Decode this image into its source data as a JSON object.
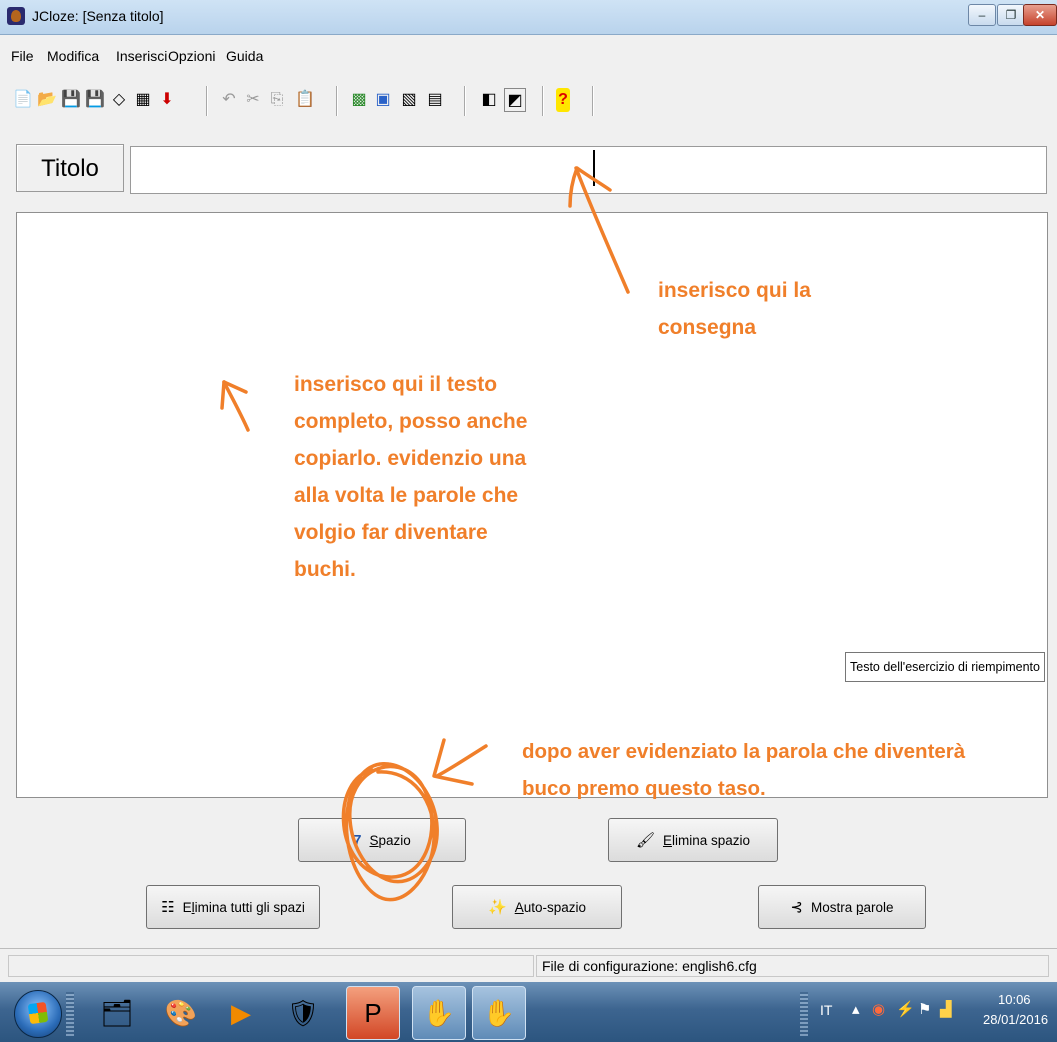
{
  "window": {
    "title": "JCloze: [Senza titolo]",
    "min": "–",
    "max": "❐",
    "close": "✕"
  },
  "menu": [
    "File",
    "Modifica",
    "Inserisci",
    "Opzioni",
    "Guida"
  ],
  "toolbar_icons": [
    "new-file-icon",
    "open-folder-icon",
    "save-icon",
    "save-as-icon",
    "eraser-icon",
    "web-page-icon",
    "export-icon",
    "undo-icon",
    "cut-icon",
    "copy-icon",
    "paste-icon",
    "export-html-icon",
    "export-flash-icon",
    "export-drag-icon",
    "export-print-icon",
    "properties-icon",
    "settings-icon",
    "help-icon"
  ],
  "title_row": {
    "label": "Titolo",
    "value": ""
  },
  "editor": {
    "text": "",
    "tooltip": "Testo dell'esercizio di riempimento"
  },
  "buttons": {
    "gap": {
      "prefix": "",
      "accel": "S",
      "rest": "pazio"
    },
    "delete_gap": {
      "prefix": "",
      "accel": "E",
      "rest": "limina spazio"
    },
    "delete_all": {
      "prefix": "E",
      "accel": "l",
      "rest": "imina tutti gli spazi"
    },
    "auto_gap": {
      "prefix": "",
      "accel": "A",
      "rest": "uto-spazio"
    },
    "show_words": {
      "prefix": "Mostra ",
      "accel": "p",
      "rest": "arole"
    }
  },
  "status": {
    "config": "File di configurazione: english6.cfg"
  },
  "taskbar": {
    "language": "IT",
    "time": "10:06",
    "date": "28/01/2016"
  },
  "annotations": {
    "consegna": [
      "inserisco qui la",
      "consegna"
    ],
    "testo": [
      "inserisco qui il testo",
      "completo, posso anche",
      "copiarlo. evidenzio una",
      "alla volta le parole che",
      "volgio far diventare",
      "buchi."
    ],
    "spazio": [
      "dopo aver evidenziato la parola che diventerà",
      "buco premo questo taso."
    ]
  },
  "colors": {
    "annotation": "#f07f2a",
    "accent": "#2b6cb8"
  }
}
